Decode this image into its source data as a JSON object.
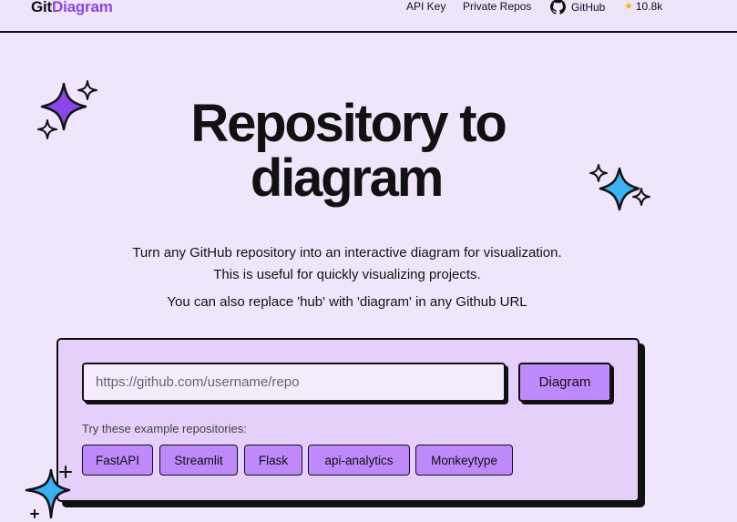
{
  "header": {
    "logo_part1": "Git",
    "logo_part2": "Diagram",
    "nav_api_key": "API Key",
    "nav_private_repos": "Private Repos",
    "nav_github": "GitHub",
    "star_icon": "star-icon",
    "star_count": "10.8k"
  },
  "hero": {
    "title_line1": "Repository to",
    "title_line2": "diagram",
    "description_line1": "Turn any GitHub repository into an interactive diagram for visualization.",
    "description_line2": "This is useful for quickly visualizing projects.",
    "description_line3": "You can also replace 'hub' with 'diagram' in any Github URL"
  },
  "form": {
    "input_placeholder": "https://github.com/username/repo",
    "input_value": "",
    "submit_label": "Diagram",
    "examples_label": "Try these example repositories:",
    "examples": [
      "FastAPI",
      "Streamlit",
      "Flask",
      "api-analytics",
      "Monkeytype"
    ]
  },
  "colors": {
    "background": "#f0e6fc",
    "accent_purple": "#8b46e6",
    "button_purple": "#bf88fb",
    "card_bg": "#e4d0fb",
    "sparkle_blue": "#38b2f2",
    "star_gold": "#f4b400"
  }
}
